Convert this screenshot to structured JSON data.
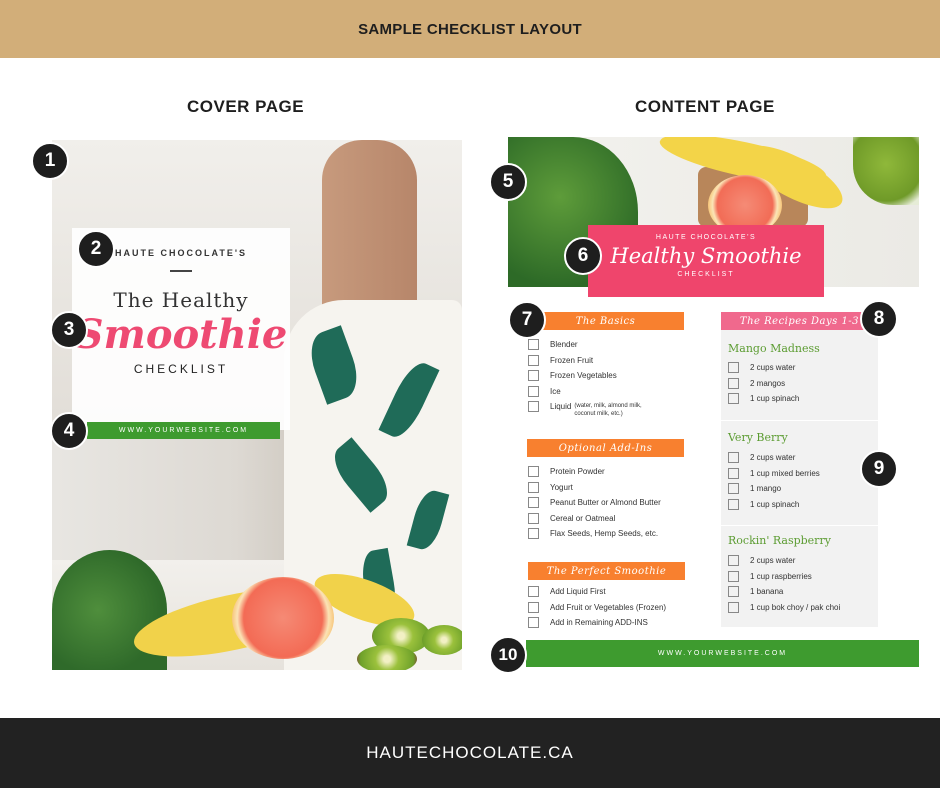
{
  "header": {
    "title": "SAMPLE CHECKLIST LAYOUT"
  },
  "sections": {
    "cover_title": "COVER PAGE",
    "content_title": "CONTENT PAGE"
  },
  "cover": {
    "brand": "HAUTE CHOCOLATE'S",
    "title_line1": "The Healthy",
    "title_line2": "Smoothie",
    "title_line3": "CHECKLIST",
    "url": "WWW.YOURWEBSITE.COM"
  },
  "content": {
    "brand": "HAUTE CHOCOLATE'S",
    "title": "Healthy Smoothie",
    "subtitle": "CHECKLIST",
    "basics": {
      "heading": "The Basics",
      "items": [
        "Blender",
        "Frozen Fruit",
        "Frozen Vegetables",
        "Ice",
        "Liquid"
      ],
      "liquid_note_1": "(water, milk, almond milk,",
      "liquid_note_2": "coconut milk, etc.)"
    },
    "addins": {
      "heading": "Optional Add-Ins",
      "items": [
        "Protein Powder",
        "Yogurt",
        "Peanut Butter or Almond Butter",
        "Cereal or Oatmeal",
        "Flax Seeds, Hemp Seeds, etc."
      ]
    },
    "perfect": {
      "heading": "The Perfect Smoothie",
      "items": [
        "Add Liquid First",
        "Add Fruit or Vegetables (Frozen)",
        "Add in Remaining ADD-INS"
      ]
    },
    "recipes": {
      "heading": "The Recipes Days 1-3",
      "list": [
        {
          "name": "Mango Madness",
          "items": [
            "2 cups water",
            "2 mangos",
            "1 cup spinach"
          ]
        },
        {
          "name": "Very Berry",
          "items": [
            "2 cups water",
            "1 cup mixed berries",
            "1 mango",
            "1 cup spinach"
          ]
        },
        {
          "name": "Rockin' Raspberry",
          "items": [
            "2 cups water",
            "1 cup raspberries",
            "1 banana",
            "1 cup bok choy / pak choi"
          ]
        }
      ]
    },
    "url": "WWW.YOURWEBSITE.COM"
  },
  "badges": [
    "1",
    "2",
    "3",
    "4",
    "5",
    "6",
    "7",
    "8",
    "9",
    "10"
  ],
  "footer": {
    "text": "HAUTECHOCOLATE.CA"
  },
  "colors": {
    "gold": "#d2ae79",
    "pink": "#ef456c",
    "orange": "#f8802f",
    "green": "#3e9b2f",
    "dark": "#222222"
  }
}
